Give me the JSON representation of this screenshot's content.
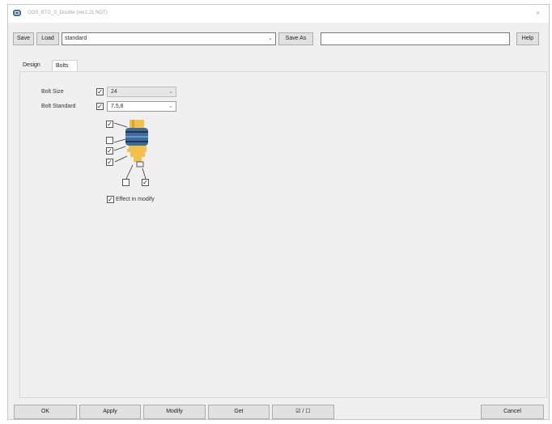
{
  "window": {
    "title": "OOS_BTG_S_Double (ver2.21 NOT)",
    "close_glyph": "×"
  },
  "toolbar": {
    "save_label": "Save",
    "load_label": "Load",
    "preset_value": "standard",
    "save_as_label": "Save As",
    "save_as_value": "",
    "help_label": "Help"
  },
  "tabs": [
    {
      "label": "Design",
      "active": false
    },
    {
      "label": "Bolts",
      "active": true
    }
  ],
  "bolts": {
    "bolt_size_label": "Bolt Size",
    "bolt_size_value": "24",
    "bolt_size_checked": true,
    "bolt_standard_label": "Bolt Standard",
    "bolt_standard_value": "7,5,8",
    "bolt_standard_checked": true,
    "effect_in_modify_label": "Effect in modify",
    "effect_in_modify_checked": true
  },
  "footer": {
    "ok_label": "OK",
    "apply_label": "Apply",
    "modify_label": "Modify",
    "get_label": "Get",
    "toggle_label": "☑ / ☐",
    "cancel_label": "Cancel"
  },
  "colors": {
    "bolt_gold": "#f3c04a",
    "bolt_blue": "#3e6b9c",
    "bolt_dark": "#1f3550"
  },
  "icons": {
    "app": "app-icon",
    "close": "close-icon",
    "chevron": "chevron-down-icon",
    "bolt": "bolt-diagram-icon"
  }
}
